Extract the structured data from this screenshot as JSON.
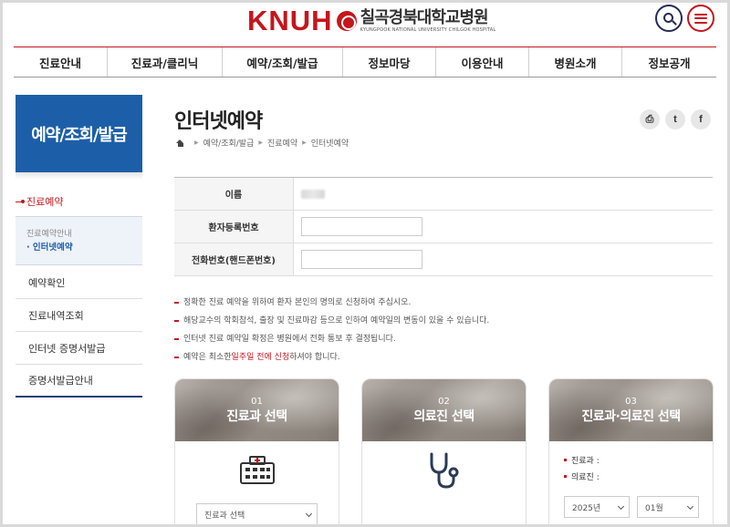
{
  "header": {
    "logo_mark": "KNUH",
    "logo_name": "칠곡경북대학교병원",
    "logo_sub": "KYUNGPOOK NATIONAL UNIVERSITY CHILGOK HOSPITAL"
  },
  "gnb": [
    {
      "label": "진료안내"
    },
    {
      "label": "진료과/클리닉"
    },
    {
      "label": "예약/조회/발급"
    },
    {
      "label": "정보마당"
    },
    {
      "label": "이용안내"
    },
    {
      "label": "병원소개"
    },
    {
      "label": "정보공개"
    }
  ],
  "sidebar": {
    "title": "예약/조회/발급",
    "active": "진료예약",
    "sub_items": [
      "진료예약안내",
      "인터넷예약"
    ],
    "menu": [
      "예약확인",
      "진료내역조회",
      "인터넷 증명서발급",
      "증명서발급안내"
    ]
  },
  "main": {
    "title": "인터넷예약",
    "breadcrumb": [
      "예약/조회/발급",
      "진료예약",
      "인터넷예약"
    ],
    "share": [
      "print-icon",
      "twitter-icon",
      "facebook-icon"
    ],
    "form": {
      "name_label": "이름",
      "reg_label": "환자등록번호",
      "phone_label": "전화번호(핸드폰번호)"
    },
    "notes": [
      "정확한 진료 예약을 위하여 환자 본인의 명의로 신청하여 주십시오.",
      "해당교수의 학회참석, 출장 및 진료마감 등으로 인하여 예약일의 변동이 있을 수 있습니다.",
      "인터넷 진료 예약일 확정은 병원에서 전화 통보 후 결정됩니다."
    ],
    "last_note": {
      "pre": "예약은 최소한 ",
      "highlight": "일주일 전에 신청",
      "post": " 하셔야 합니다."
    },
    "steps": [
      {
        "num": "01",
        "title": "진료과 선택",
        "icon": "hospital-icon",
        "select": "진료과 선택"
      },
      {
        "num": "02",
        "title": "의료진 선택",
        "icon": "stethoscope-icon"
      },
      {
        "num": "03",
        "title": "진료과·의료진 선택",
        "dept_label": "진료과 :",
        "doctor_label": "의료진 :",
        "year": "2025년",
        "month": "01월"
      }
    ]
  }
}
